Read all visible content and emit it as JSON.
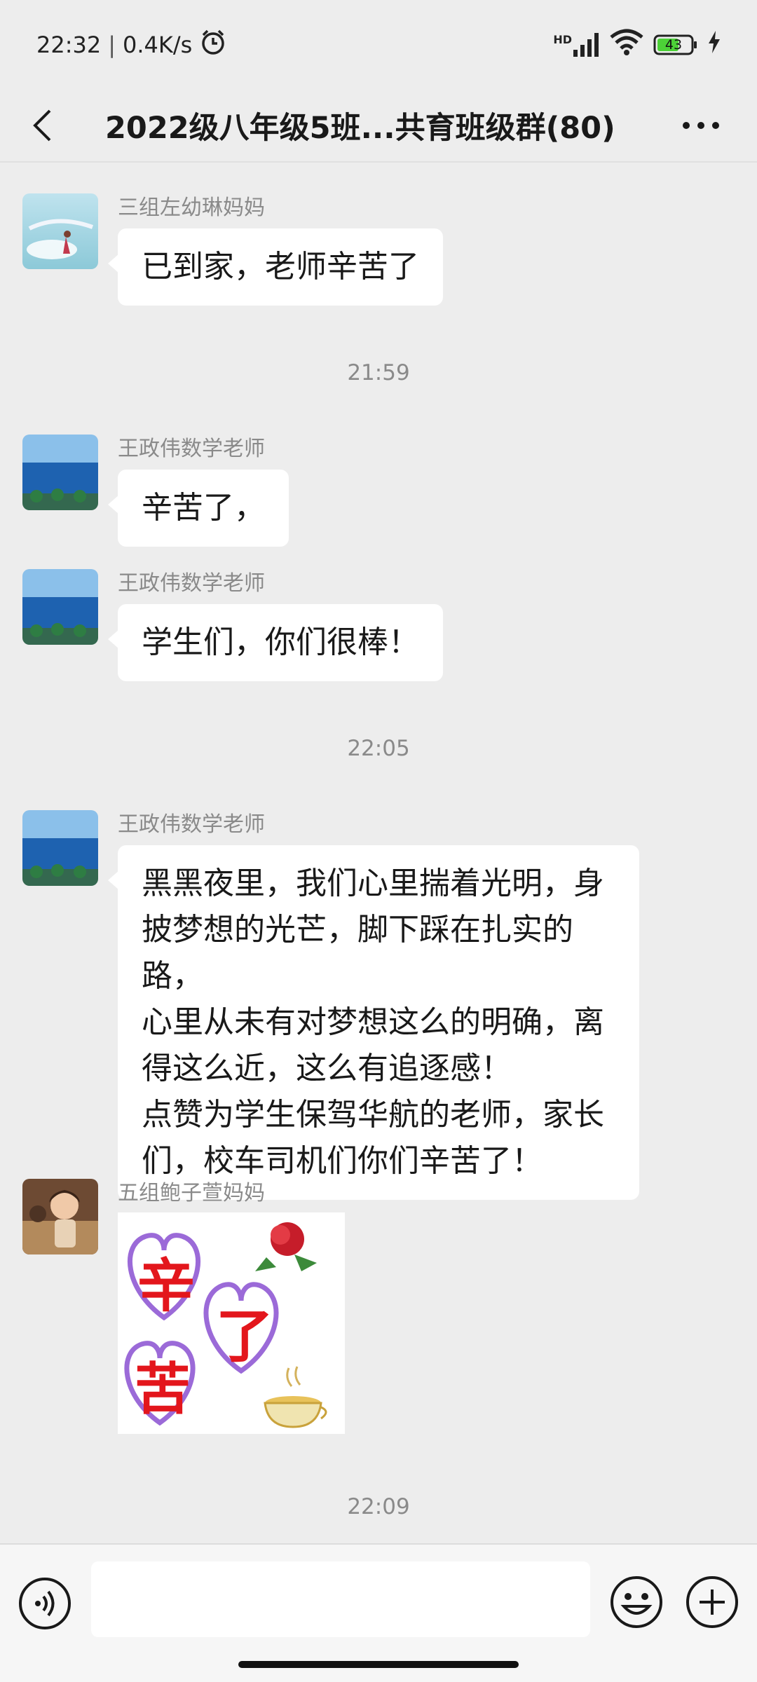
{
  "status_bar": {
    "time": "22:32",
    "separator": "|",
    "speed": "0.4K/s",
    "network_label": "HD",
    "battery": "43"
  },
  "nav": {
    "title": "2022级八年级5班...共育班级群(80)"
  },
  "messages": [
    {
      "sender": "三组左幼琳妈妈",
      "text": "已到家，老师辛苦了"
    },
    {
      "time": "21:59"
    },
    {
      "sender": "王政伟数学老师",
      "text": "辛苦了，"
    },
    {
      "sender": "王政伟数学老师",
      "text": "学生们，你们很棒！"
    },
    {
      "time": "22:05"
    },
    {
      "sender": "王政伟数学老师",
      "lines": [
        "黑黑夜里，我们心里揣着光明，身",
        "披梦想的光芒，脚下踩在扎实的路，",
        "心里从未有对梦想这么的明确，离",
        "得这么近，这么有追逐感！",
        "点赞为学生保驾华航的老师，家长",
        "们，校车司机们你们辛苦了！"
      ]
    },
    {
      "sender": "五组鲍子萱妈妈",
      "sticker": {
        "chars": [
          "辛",
          "苦",
          "了"
        ]
      }
    },
    {
      "time": "22:09"
    }
  ],
  "input": {
    "placeholder": ""
  },
  "colors": {
    "background": "#ededed",
    "bubble": "#ffffff",
    "sticker_text": "#e3161c",
    "sticker_heart": "#9b6ad8"
  }
}
